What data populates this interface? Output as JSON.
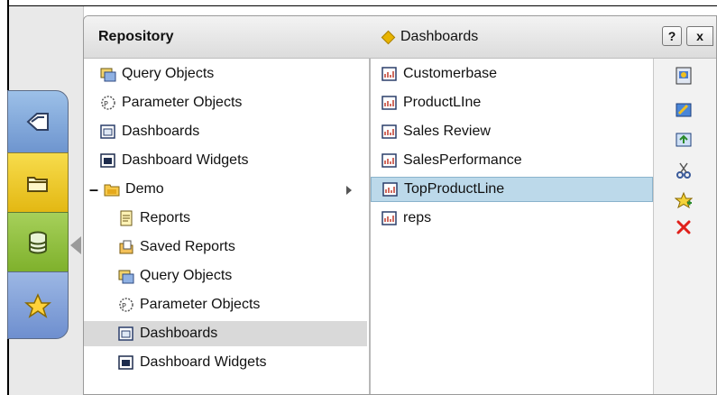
{
  "header": {
    "title": "Repository",
    "breadcrumb": "Dashboards",
    "help_label": "?",
    "close_label": "x"
  },
  "tree": [
    {
      "label": "Query Objects",
      "icon": "query-objects-icon"
    },
    {
      "label": "Parameter Objects",
      "icon": "parameter-objects-icon"
    },
    {
      "label": "Dashboards",
      "icon": "dashboards-icon"
    },
    {
      "label": "Dashboard Widgets",
      "icon": "dashboard-widgets-icon"
    },
    {
      "label": "Demo",
      "icon": "folder-icon"
    },
    {
      "label": "Reports",
      "icon": "reports-icon"
    },
    {
      "label": "Saved Reports",
      "icon": "saved-reports-icon"
    },
    {
      "label": "Query Objects",
      "icon": "query-objects-icon"
    },
    {
      "label": "Parameter Objects",
      "icon": "parameter-objects-icon"
    },
    {
      "label": "Dashboards",
      "icon": "dashboards-icon"
    },
    {
      "label": "Dashboard Widgets",
      "icon": "dashboard-widgets-icon"
    }
  ],
  "dashboards": [
    {
      "label": "Customerbase"
    },
    {
      "label": "ProductLIne"
    },
    {
      "label": "Sales Review"
    },
    {
      "label": "SalesPerformance"
    },
    {
      "label": "TopProductLine"
    },
    {
      "label": "reps"
    }
  ],
  "toolbar": [
    "open-icon",
    "edit-icon",
    "refresh-icon",
    "cut-icon",
    "favorite-add-icon",
    "delete-icon"
  ],
  "colors": {
    "selected_row": "#d9d9d9",
    "selected_item": "#bcd9ea",
    "tab_blue": "#7fa3d8",
    "tab_yellow": "#eec92a",
    "tab_green": "#8dbd3a"
  }
}
